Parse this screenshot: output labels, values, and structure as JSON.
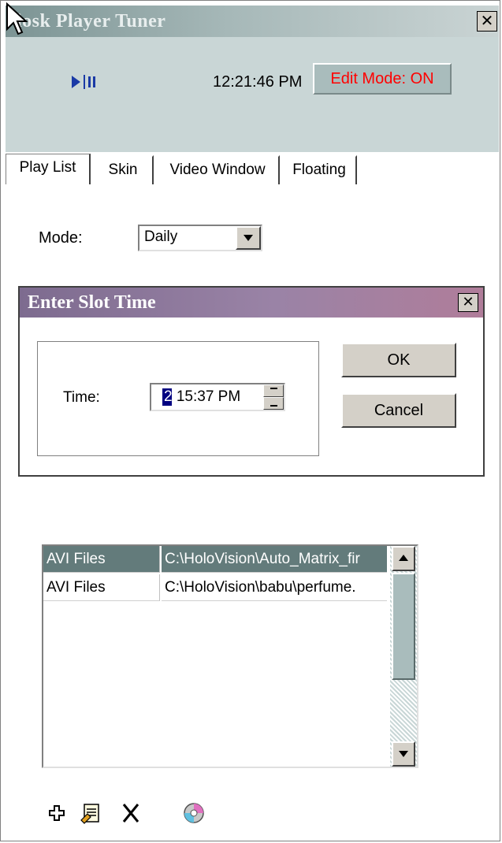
{
  "window": {
    "title": "iosk Player Tuner",
    "close_glyph": "✕"
  },
  "header": {
    "transport_icon": "play-pause-icon",
    "clock": "12:21:46 PM",
    "edit_mode": "Edit Mode: ON",
    "edit_mode_color": "#ff0000"
  },
  "tabs": [
    {
      "label": "Play List",
      "active": true
    },
    {
      "label": "Skin",
      "active": false
    },
    {
      "label": "Video Window",
      "active": false
    },
    {
      "label": "Floating",
      "active": false
    }
  ],
  "playlist": {
    "mode_label": "Mode:",
    "mode_value": "Daily"
  },
  "dialog": {
    "title": "Enter Slot Time",
    "close_glyph": "✕",
    "time_label": "Time:",
    "time_value": "2:15:37 PM",
    "ok_label": "OK",
    "cancel_label": "Cancel"
  },
  "file_list": {
    "rows": [
      {
        "type": "AVI Files",
        "path": "C:\\HoloVision\\Auto_Matrix_fir",
        "selected": true
      },
      {
        "type": "AVI Files",
        "path": "C:\\HoloVision\\babu\\perfume.",
        "selected": false
      }
    ]
  },
  "toolbar": {
    "icons": [
      "add-icon",
      "edit-file-icon",
      "delete-icon",
      "cd-icon"
    ]
  },
  "colors": {
    "selection": "#637b7b",
    "title_gradient_start": "#7c9494",
    "dialog_gradient_start": "#7d6b8f"
  }
}
